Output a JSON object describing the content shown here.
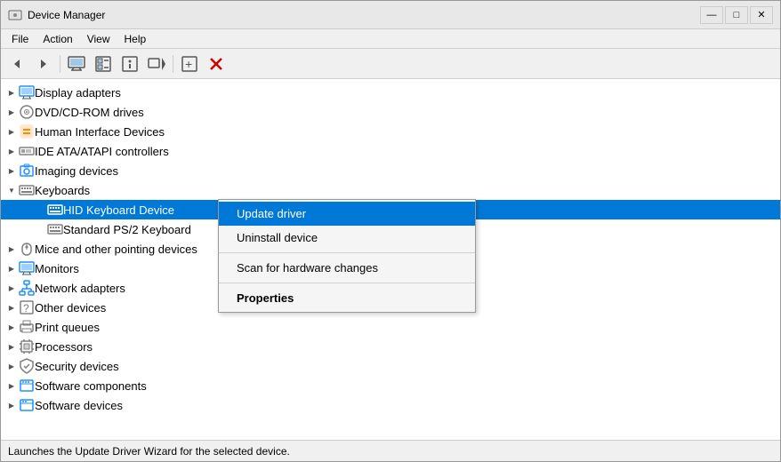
{
  "window": {
    "title": "Device Manager",
    "icon": "⚙"
  },
  "titlebar": {
    "minimize_label": "—",
    "maximize_label": "□",
    "close_label": "✕"
  },
  "menubar": {
    "items": [
      {
        "label": "File",
        "id": "file"
      },
      {
        "label": "Action",
        "id": "action"
      },
      {
        "label": "View",
        "id": "view"
      },
      {
        "label": "Help",
        "id": "help"
      }
    ]
  },
  "toolbar": {
    "buttons": [
      {
        "id": "back",
        "icon": "◀",
        "disabled": false
      },
      {
        "id": "forward",
        "icon": "▶",
        "disabled": false
      },
      {
        "id": "computer",
        "icon": "🖥",
        "disabled": false
      },
      {
        "id": "grid",
        "icon": "▦",
        "disabled": false
      },
      {
        "id": "info",
        "icon": "ℹ",
        "disabled": false
      },
      {
        "id": "update",
        "icon": "⬆",
        "disabled": false
      },
      {
        "id": "flag",
        "icon": "⚐",
        "disabled": false
      },
      {
        "id": "cancel",
        "icon": "✕",
        "disabled": false,
        "color": "red"
      }
    ]
  },
  "tree": {
    "items": [
      {
        "id": "display-adapters",
        "label": "Display adapters",
        "level": 0,
        "expanded": false,
        "icon": "monitor"
      },
      {
        "id": "dvd-cdrom",
        "label": "DVD/CD-ROM drives",
        "level": 0,
        "expanded": false,
        "icon": "disc"
      },
      {
        "id": "human-interface",
        "label": "Human Interface Devices",
        "level": 0,
        "expanded": false,
        "icon": "hid"
      },
      {
        "id": "ide-atapi",
        "label": "IDE ATA/ATAPI controllers",
        "level": 0,
        "expanded": false,
        "icon": "ide"
      },
      {
        "id": "imaging",
        "label": "Imaging devices",
        "level": 0,
        "expanded": false,
        "icon": "camera"
      },
      {
        "id": "keyboards",
        "label": "Keyboards",
        "level": 0,
        "expanded": true,
        "icon": "keyboard"
      },
      {
        "id": "hid-keyboard",
        "label": "HID Keyboard Device",
        "level": 1,
        "expanded": false,
        "icon": "keyboard",
        "selected": true
      },
      {
        "id": "standard-ps2",
        "label": "Standard PS/2 Keyboard",
        "level": 1,
        "expanded": false,
        "icon": "keyboard",
        "selected": false
      },
      {
        "id": "mice",
        "label": "Mice and other pointing devices",
        "level": 0,
        "expanded": false,
        "icon": "mouse"
      },
      {
        "id": "monitors",
        "label": "Monitors",
        "level": 0,
        "expanded": false,
        "icon": "monitor"
      },
      {
        "id": "network",
        "label": "Network adapters",
        "level": 0,
        "expanded": false,
        "icon": "network"
      },
      {
        "id": "other-devices",
        "label": "Other devices",
        "level": 0,
        "expanded": false,
        "icon": "device"
      },
      {
        "id": "print-queues",
        "label": "Print queues",
        "level": 0,
        "expanded": false,
        "icon": "print"
      },
      {
        "id": "processors",
        "label": "Processors",
        "level": 0,
        "expanded": false,
        "icon": "cpu"
      },
      {
        "id": "security",
        "label": "Security devices",
        "level": 0,
        "expanded": false,
        "icon": "security"
      },
      {
        "id": "software-components",
        "label": "Software components",
        "level": 0,
        "expanded": false,
        "icon": "software"
      },
      {
        "id": "software-devices",
        "label": "Software devices",
        "level": 0,
        "expanded": false,
        "icon": "software"
      }
    ]
  },
  "context_menu": {
    "visible": true,
    "items": [
      {
        "id": "update-driver",
        "label": "Update driver",
        "bold": false,
        "separator_after": false,
        "highlighted": true
      },
      {
        "id": "uninstall-device",
        "label": "Uninstall device",
        "bold": false,
        "separator_after": true,
        "highlighted": false
      },
      {
        "id": "scan-changes",
        "label": "Scan for hardware changes",
        "bold": false,
        "separator_after": false,
        "highlighted": false
      },
      {
        "id": "properties",
        "label": "Properties",
        "bold": true,
        "separator_after": false,
        "highlighted": false
      }
    ]
  },
  "statusbar": {
    "text": "Launches the Update Driver Wizard for the selected device."
  }
}
